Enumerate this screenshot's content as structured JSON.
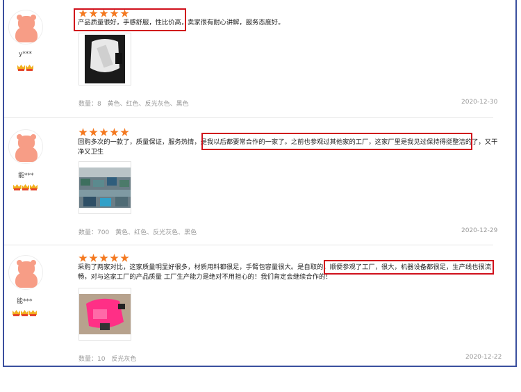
{
  "reviews": [
    {
      "user": "y***",
      "stars": 5,
      "text": "产品质量很好，手感舒服，性比价高，卖家很有耐心讲解，服务态度好。",
      "quantity_label": "数量：8",
      "colors": "黄色、红色、反光灰色、黑色",
      "date": "2020-12-30"
    },
    {
      "user": "能***",
      "stars": 5,
      "text_line1": "回购多次的一款了，质量保证，服务热情，是我以后都要常合作的一家了。之前也参观过其他家的工厂，这家厂里是我见过保持得挺整洁的了，又干",
      "text_line2": "净又卫生",
      "quantity_label": "数量：700",
      "colors": "黄色、红色、反光灰色、黑色",
      "date": "2020-12-29"
    },
    {
      "user": "能***",
      "stars": 5,
      "text_line1": "采购了两家对比，这家质量明显好很多，材质用料都很足，手臂包容量很大。是自取的，顺便参观了工厂，很大，机器设备都很足，生产线也很流",
      "text_line2": "畅，对与这家工厂的产品质量 工厂生产能力是绝对不用担心的！我们肯定会继续合作的！",
      "quantity_label": "数量：10",
      "colors": "反光灰色",
      "date": "2020-12-22"
    }
  ],
  "colors": {
    "star": "#f47920",
    "highlight": "#d0101b",
    "frame": "#3a4f9e"
  }
}
